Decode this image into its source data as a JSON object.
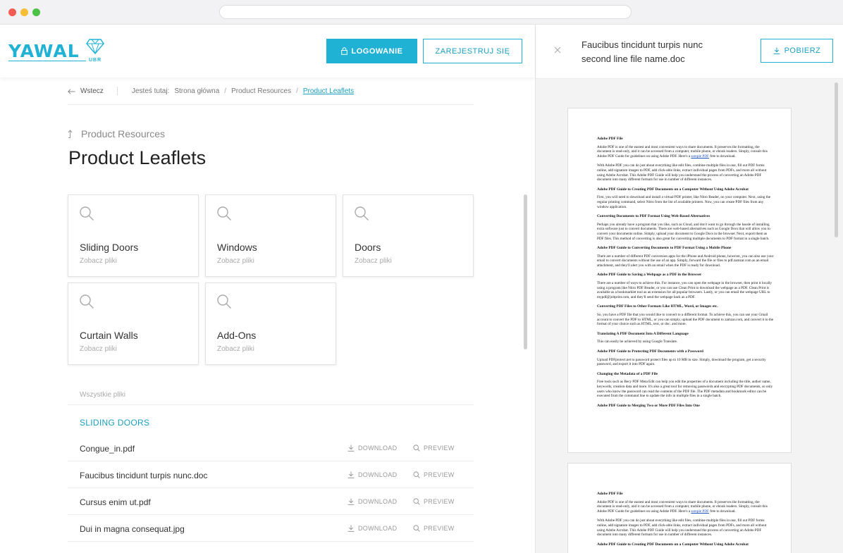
{
  "header": {
    "logo_text": "YAWAL",
    "logo_sub": "UBR",
    "login_label": "LOGOWANIE",
    "register_label": "ZAREJESTRUJ SIĘ"
  },
  "breadcrumb": {
    "back_label": "Wstecz",
    "intro": "Jesteś tutaj:",
    "items": [
      "Strona główna",
      "Product Resources",
      "Product Leaflets"
    ]
  },
  "page": {
    "parent_label": "Product Resources",
    "title": "Product Leaflets"
  },
  "categories": [
    {
      "title": "Sliding Doors",
      "subtitle": "Zobacz pliki"
    },
    {
      "title": "Windows",
      "subtitle": "Zobacz pliki"
    },
    {
      "title": "Doors",
      "subtitle": "Zobacz pliki"
    },
    {
      "title": "Curtain Walls",
      "subtitle": "Zobacz pliki"
    },
    {
      "title": "Add-Ons",
      "subtitle": "Zobacz pliki"
    }
  ],
  "files": {
    "all_label": "Wszystkie pliki",
    "section_title": "SLIDING DOORS",
    "download_label": "DOWNLOAD",
    "preview_label": "PREVIEW",
    "items": [
      {
        "name": "Congue_in.pdf"
      },
      {
        "name": "Faucibus tincidunt turpis nunc.doc"
      },
      {
        "name": "Cursus enim ut.pdf"
      },
      {
        "name": "Dui in magna consequat.jpg"
      }
    ]
  },
  "preview": {
    "doc_name_line1": "Faucibus tincidunt turpis nunc",
    "doc_name_line2": "second line file name.doc",
    "download_label": "POBIERZ",
    "page1": {
      "h1": "Adobe PDF File",
      "p1a": "Adobe PDF is one of the easiest and most convenient ways to share documents. It preserves the formatting, the document is read-only, and it can be accessed from a computer, mobile phone, or ebook readers. Simply, consult this Adobe PDF Guide for guidelines on using Adobe PDF.  Here's a",
      "p1link": "sample PDF",
      "p1b": "free to download.",
      "p2": "With Adobe PDF you can do just about everything like edit files, combine multiple files in one, fill out PDF forms online, add signature images to PDF, add click-able links, extract individual pages from PDFs, and more all without using Adobe Acrobat. This Adobe PDF Guide will help you understand the process of converting an Adobe PDF document into many different formats for use in number of different instances.",
      "h2": "Adobe PDF Guide to Creating PDF Documents on a Computer Without Using Adobe Acrobat",
      "p3": "First, you will need to download and install a virtual PDF printer, like Nitro Reader, on your computer. Next, using the regular printing command, select Nitro from the list of available printers. Now, you can create PDF files from any window application.",
      "h3": "Converting Documents to PDF Format Using Web-Based Alternatives",
      "p4": "Perhaps you already have a program that you like, such as Cloud, and don't want to go through the hassle of installing extra software just to convert documents. There are web-based alternatives such as Google Docs that will allow you to convert your documents online. Simply, upload your document to Google Docs in the browser. Next, export them as PDF files. This method of converting is also great for converting multiple documents to PDF format in a single batch.",
      "h4": "Adobe PDF Guide to Converting Documents to PDF Format Using a Mobile Phone",
      "p5": "There are a number of different PDF conversion apps for the iPhone and Android phone, however, you can also use your email to convert documents without the use of an app. Simply, forward the file or files to pdf.zamzar.com as an email attachment, and they'll alert you with an email when the PDF is ready for download.",
      "h5": "Adobe PDF Guide to Saving a Webpage as a PDF in the Browser",
      "p6": "There are a number of ways to achieve this. For instance, you can open the webpage in the browser, then print it locally using a program like Nitro PDF Reader, or you can use Clean Print to download the webpage as a PDF. Clean Print is available as a bookmarklet tool as an extension for all popular browsers. Lastly, or you can email the webpage URL to mypdf@joltprint.com, and they'll send the webpage back as a PDF.",
      "h6": "Converting PDF Files to Other Formats Like HTML, Word, or Images etc.",
      "p7": "So, you have a PDF file that you would like to convert to a different format. To achieve this, you can use your Gmail account to convert the PDF to HTML, or you can simply, upload the PDF document to zamzar.com, and convert it to the format of your choice such as HTML, text, or doc. and more.",
      "h7": "Translating A PDF Document Into A Different Language",
      "p8": "This can easily be achieved by using Google Translate.",
      "h8": "Adobe PDF Guide to Protecting PDF Documents with a Password",
      "p9": "Upload PDFprotect.net to password protect files up to 10 MB in size. Simply, download the program, get a security password, and export it into PDF again.",
      "h9": "Changing the Metadata of a PDF File",
      "p10": "Free tools such as Becy PDF Meta Edit can help you edit the properties of a document including the title, author name, keywords, creation data and more. It's also a great tool for removing passwords and encrypting PDF documents, so only users who know the password can read the contents of the PDF file. The PDF metadata and bookmark editor can be executed from the command line to update the info in multiple files in a single batch.",
      "h10": "Adobe PDF Guide to Merging Two or More PDF Files Into One"
    }
  }
}
